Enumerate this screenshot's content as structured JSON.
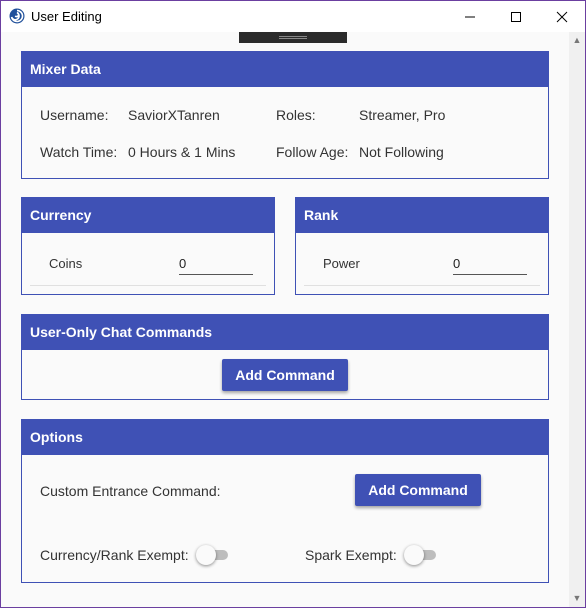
{
  "window": {
    "title": "User Editing",
    "icon": "swirl-app-icon",
    "controls": [
      "minimize-icon",
      "maximize-icon",
      "close-icon"
    ]
  },
  "mixer": {
    "title": "Mixer Data",
    "username_label": "Username:",
    "username": "SaviorXTanren",
    "roles_label": "Roles:",
    "roles": "Streamer, Pro",
    "watch_time_label": "Watch Time:",
    "watch_time": "0 Hours & 1 Mins",
    "follow_age_label": "Follow Age:",
    "follow_age": "Not Following"
  },
  "currency": {
    "title": "Currency",
    "item_label": "Coins",
    "item_value": "0"
  },
  "rank": {
    "title": "Rank",
    "item_label": "Power",
    "item_value": "0"
  },
  "commands": {
    "title": "User-Only Chat Commands",
    "add_button": "Add Command"
  },
  "options": {
    "title": "Options",
    "entrance_label": "Custom Entrance Command:",
    "add_button": "Add Command",
    "currency_exempt_label": "Currency/Rank Exempt:",
    "currency_exempt_on": false,
    "spark_exempt_label": "Spark Exempt:",
    "spark_exempt_on": false
  },
  "colors": {
    "accent": "#3f51b5",
    "window_border": "#6b3fa0"
  }
}
